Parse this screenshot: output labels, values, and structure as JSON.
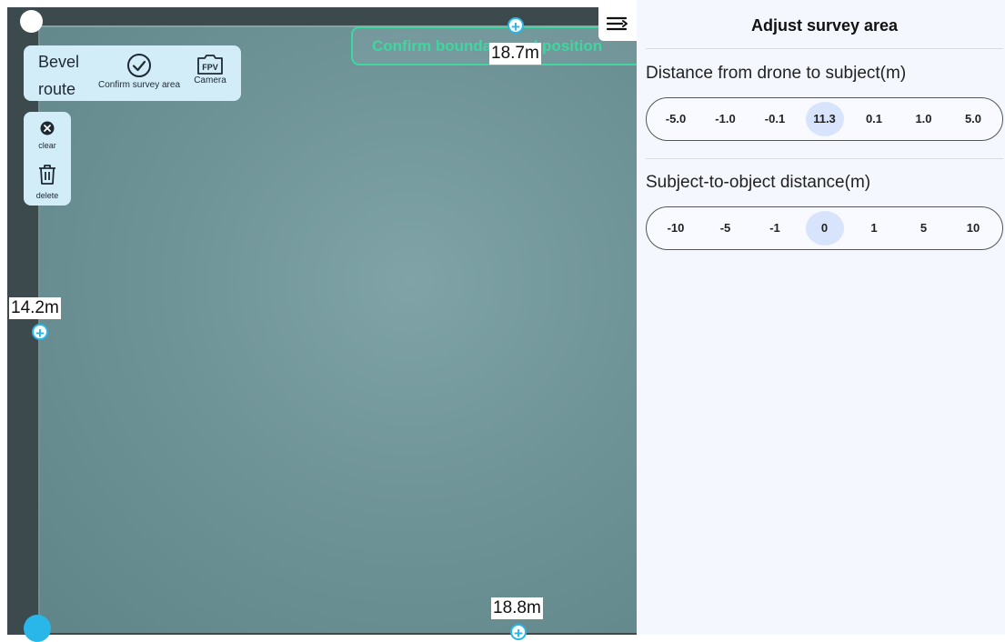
{
  "map": {
    "confirm_banner": "Confirm boundary and position",
    "distances": {
      "top": "18.7m",
      "left": "14.2m",
      "bottom": "18.8m"
    },
    "plus_symbol": "+"
  },
  "toolbar": {
    "route_label": "Bevel route",
    "confirm_area_label": "Confirm survey area",
    "camera_label": "Camera",
    "camera_icon_text": "FPV"
  },
  "side_tools": {
    "clear_label": "clear",
    "delete_label": "delete"
  },
  "panel": {
    "title": "Adjust survey area",
    "drone_distance": {
      "label": "Distance from drone to subject(m)",
      "options": [
        "-5.0",
        "-1.0",
        "-0.1",
        "11.3",
        "0.1",
        "1.0",
        "5.0"
      ],
      "selected": "11.3"
    },
    "object_distance": {
      "label": "Subject-to-object distance(m)",
      "options": [
        "-10",
        "-5",
        "-1",
        "0",
        "1",
        "5",
        "10"
      ],
      "selected": "0"
    }
  },
  "colors": {
    "accent": "#29b6e8",
    "confirm_green": "#3fd6a0",
    "toolbar_bg": "#d2ecf8",
    "selected_step_bg": "#d7e4fb"
  }
}
